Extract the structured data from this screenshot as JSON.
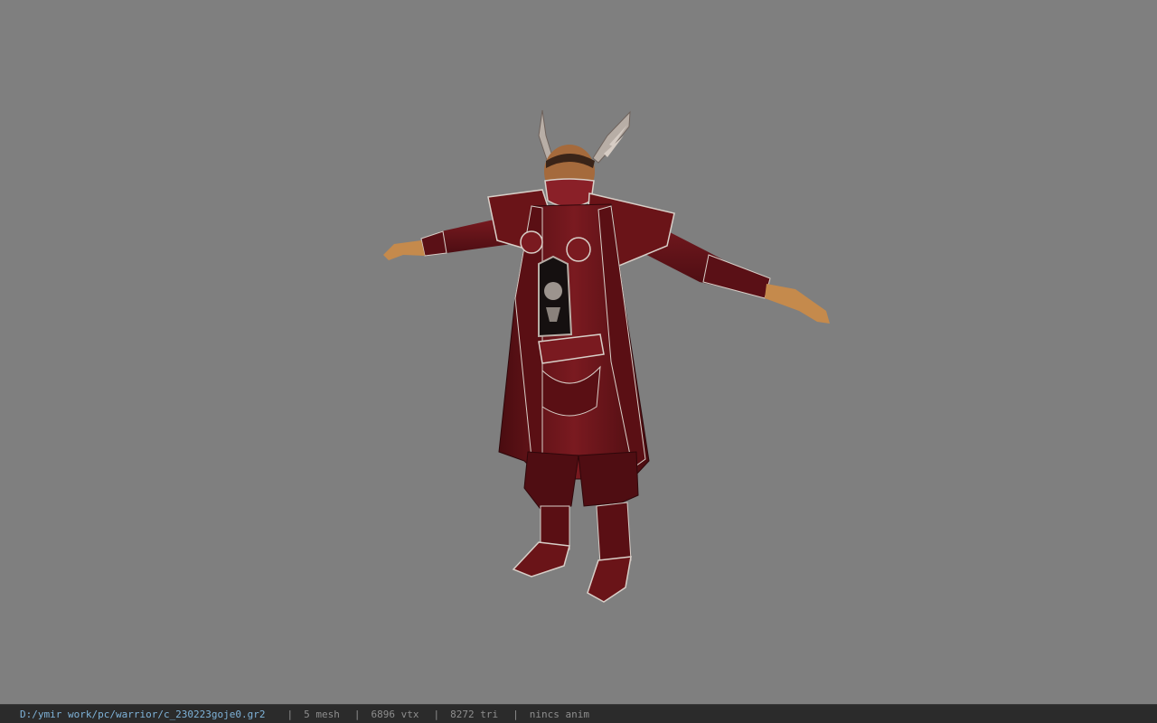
{
  "viewport": {
    "background_color": "#7f7f7f",
    "subject_icon": "armored-warrior-model"
  },
  "status_bar": {
    "path": "D:/ymir work/pc/warrior/c_230223goje0.gr2",
    "separator": "|",
    "mesh": "5 mesh",
    "vtx": "6896 vtx",
    "tri": "8272 tri",
    "anim": "nincs anim",
    "path_color": "#7fb3d9"
  }
}
